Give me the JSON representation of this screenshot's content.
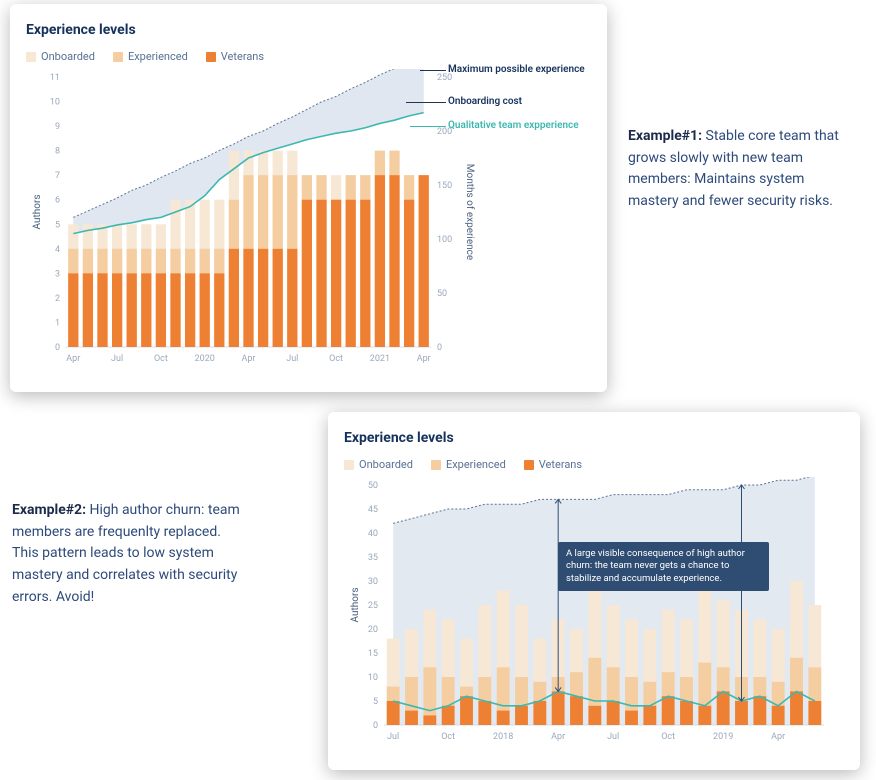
{
  "captions": {
    "ex1_label": "Example#1:",
    "ex1_text": " Stable core team that grows slowly with new team members: Maintains system mastery and fewer security risks.",
    "ex2_label": "Example#2:",
    "ex2_text": " High author churn: team members are frequenlty replaced. This pattern leads to low system mastery and correlates with security errors. Avoid!"
  },
  "colors": {
    "onboarded": "#f7e7d5",
    "experienced": "#f4cda0",
    "veterans_solid": "#ee8033",
    "teal": "#3db8b0",
    "dash": "#5a7596",
    "tooltip_bg": "#2f4d73"
  },
  "chart_data": [
    {
      "id": "chart1",
      "title": "Experience levels",
      "type": "bar",
      "legend": [
        {
          "name": "Onboarded",
          "swatch": "onboarded"
        },
        {
          "name": "Experienced",
          "swatch": "experienced"
        },
        {
          "name": "Veterans",
          "swatch": "veterans_solid"
        }
      ],
      "x_ticks": [
        "Apr",
        "Jul",
        "Oct",
        "2020",
        "Apr",
        "Jul",
        "Oct",
        "2021",
        "Apr"
      ],
      "categories": [
        "2019-04",
        "2019-05",
        "2019-06",
        "2019-07",
        "2019-08",
        "2019-09",
        "2019-10",
        "2019-11",
        "2019-12",
        "2020-01",
        "2020-02",
        "2020-03",
        "2020-04",
        "2020-05",
        "2020-06",
        "2020-07",
        "2020-08",
        "2020-09",
        "2020-10",
        "2020-11",
        "2020-12",
        "2021-01",
        "2021-02",
        "2021-03",
        "2021-04"
      ],
      "y_left_label": "Authors",
      "y_left_ticks": [
        0,
        1,
        2,
        3,
        4,
        5,
        6,
        7,
        8,
        9,
        10,
        11
      ],
      "y_right_label": "Months of experience",
      "y_right_ticks": [
        0,
        50,
        100,
        150,
        200,
        250
      ],
      "series": [
        {
          "name": "Onboarded",
          "stack": "bar",
          "values": [
            5,
            5,
            5,
            5,
            5,
            5,
            5,
            6,
            6,
            6,
            6,
            8,
            8,
            8,
            8,
            8,
            7,
            7,
            7,
            7,
            7,
            8,
            8,
            7,
            7
          ]
        },
        {
          "name": "Experienced",
          "stack": "bar",
          "values": [
            4,
            4,
            4,
            4,
            4,
            4,
            4,
            4,
            4,
            4,
            4,
            6,
            7,
            7,
            7,
            7,
            7,
            7,
            6,
            7,
            7,
            8,
            8,
            7,
            7
          ]
        },
        {
          "name": "Veterans",
          "stack": "bar",
          "values": [
            3,
            3,
            3,
            3,
            3,
            3,
            3,
            3,
            3,
            3,
            3,
            4,
            4,
            4,
            4,
            4,
            6,
            6,
            6,
            6,
            6,
            7,
            7,
            6,
            7
          ]
        },
        {
          "name": "Maximum possible experience",
          "stack": "line",
          "axis": "right",
          "values": [
            120,
            126,
            132,
            138,
            145,
            150,
            157,
            163,
            170,
            175,
            182,
            188,
            195,
            200,
            207,
            213,
            220,
            227,
            232,
            239,
            245,
            252,
            258,
            265,
            280
          ]
        },
        {
          "name": "Qualitative team expperience",
          "stack": "line",
          "axis": "right",
          "values": [
            105,
            108,
            110,
            113,
            115,
            118,
            120,
            125,
            130,
            140,
            155,
            165,
            175,
            180,
            184,
            188,
            192,
            195,
            198,
            200,
            203,
            207,
            210,
            214,
            217
          ]
        }
      ],
      "annotations": [
        {
          "label": "Maximum possible experience",
          "kind": "max_exp"
        },
        {
          "label": "Onboarding cost",
          "kind": "onboard_cost"
        },
        {
          "label": "Qualitative team expperience",
          "kind": "qual_exp"
        }
      ]
    },
    {
      "id": "chart2",
      "title": "Experience levels",
      "type": "bar",
      "legend": [
        {
          "name": "Onboarded",
          "swatch": "onboarded"
        },
        {
          "name": "Experienced",
          "swatch": "experienced"
        },
        {
          "name": "Veterans",
          "swatch": "veterans_solid"
        }
      ],
      "x_ticks": [
        "Jul",
        "Oct",
        "2018",
        "Apr",
        "Jul",
        "Oct",
        "2019",
        "Apr"
      ],
      "categories": [
        "2017-07",
        "2017-08",
        "2017-09",
        "2017-10",
        "2017-11",
        "2017-12",
        "2018-01",
        "2018-02",
        "2018-03",
        "2018-04",
        "2018-05",
        "2018-06",
        "2018-07",
        "2018-08",
        "2018-09",
        "2018-10",
        "2018-11",
        "2018-12",
        "2019-01",
        "2019-02",
        "2019-03",
        "2019-04",
        "2019-05",
        "2019-06"
      ],
      "y_left_label": "Authors",
      "y_left_ticks": [
        0,
        5,
        10,
        15,
        20,
        25,
        30,
        35,
        40,
        45,
        50
      ],
      "series": [
        {
          "name": "Onboarded",
          "stack": "bar",
          "values": [
            18,
            20,
            24,
            22,
            18,
            25,
            28,
            25,
            18,
            22,
            20,
            28,
            25,
            22,
            20,
            24,
            22,
            30,
            26,
            24,
            22,
            20,
            30,
            25
          ]
        },
        {
          "name": "Experienced",
          "stack": "bar",
          "values": [
            8,
            10,
            12,
            10,
            8,
            10,
            12,
            10,
            9,
            10,
            11,
            14,
            12,
            10,
            9,
            11,
            10,
            13,
            12,
            10,
            10,
            9,
            14,
            12
          ]
        },
        {
          "name": "Veterans",
          "stack": "bar",
          "values": [
            5,
            3,
            2,
            4,
            6,
            5,
            3,
            4,
            5,
            7,
            6,
            4,
            5,
            3,
            4,
            6,
            5,
            4,
            7,
            5,
            6,
            4,
            7,
            5
          ]
        },
        {
          "name": "Maximum possible experience",
          "stack": "line",
          "values": [
            42,
            43,
            44,
            45,
            45,
            46,
            46,
            46,
            47,
            47,
            47,
            47,
            48,
            48,
            48,
            48,
            49,
            49,
            49,
            50,
            50,
            51,
            51,
            52
          ]
        },
        {
          "name": "Qualitative team experience",
          "stack": "line",
          "values": [
            5,
            4,
            3,
            4,
            6,
            5,
            4,
            4,
            5,
            7,
            6,
            5,
            5,
            4,
            4,
            6,
            5,
            4,
            7,
            5,
            6,
            4,
            7,
            5
          ]
        }
      ],
      "tooltip": "A large visible consequence of high author churn: the team never gets a chance to stabilize and accumulate experience.",
      "arrows": true
    }
  ]
}
